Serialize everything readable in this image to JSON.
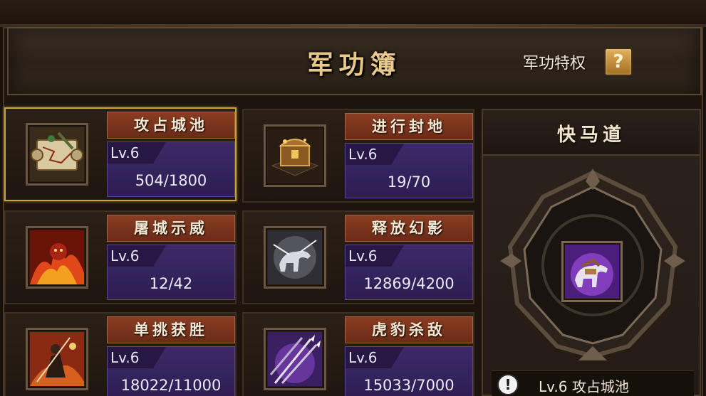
{
  "header": {
    "title": "军功簿",
    "privilege_label": "军功特权",
    "help_label": "?"
  },
  "cards": [
    {
      "name": "攻占城池",
      "level": "Lv.6",
      "progress": "504/1800",
      "icon": "scroll-map-icon",
      "selected": true
    },
    {
      "name": "进行封地",
      "level": "Lv.6",
      "progress": "19/70",
      "icon": "treasure-chest-icon",
      "selected": false
    },
    {
      "name": "屠城示威",
      "level": "Lv.6",
      "progress": "12/42",
      "icon": "flame-warrior-icon",
      "selected": false
    },
    {
      "name": "释放幻影",
      "level": "Lv.6",
      "progress": "12869/4200",
      "icon": "phantom-horse-icon",
      "selected": false
    },
    {
      "name": "单挑获胜",
      "level": "Lv.6",
      "progress": "18022/11000",
      "icon": "duel-warrior-icon",
      "selected": false
    },
    {
      "name": "虎豹杀敌",
      "level": "Lv.6",
      "progress": "15033/7000",
      "icon": "spears-icon",
      "selected": false
    }
  ],
  "side_panel": {
    "title": "快马道",
    "reward_icon": "purple-horse-icon",
    "footer_text": "Lv.6 攻占城池",
    "footer_icon": "exclamation-icon",
    "footer_icon_glyph": "!"
  }
}
